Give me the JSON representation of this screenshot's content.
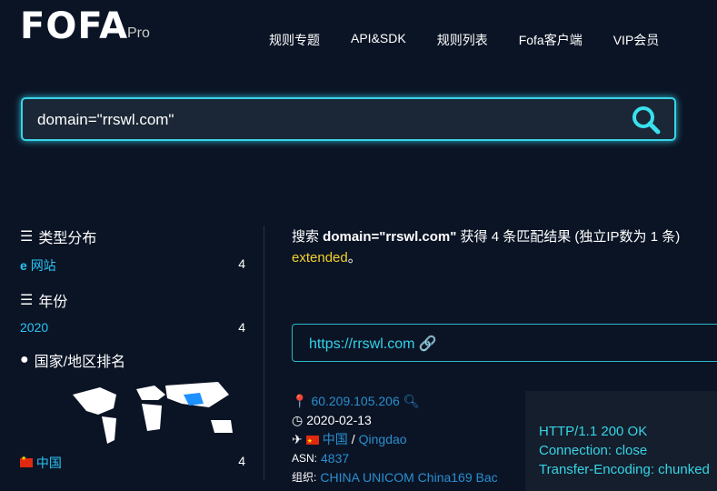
{
  "app": {
    "logo_text": "FOFA",
    "logo_sub": "Pro"
  },
  "nav": [
    "规则专题",
    "API&SDK",
    "规则列表",
    "Fofa客户端",
    "VIP会员"
  ],
  "search": {
    "value": "domain=\"rrswl.com\""
  },
  "sidebar": {
    "type_title": "类型分布",
    "type_items": [
      {
        "label": "网站",
        "count": "4"
      }
    ],
    "year_title": "年份",
    "year_items": [
      {
        "label": "2020",
        "count": "4"
      }
    ],
    "country_title": "国家/地区排名",
    "country_items": [
      {
        "label": "中国",
        "count": "4"
      }
    ]
  },
  "result": {
    "summary_prefix": "搜索 ",
    "query": "domain=\"rrswl.com\"",
    "summary_suffix": " 获得 4 条匹配结果 (独立IP数为 1 条)",
    "extended": "extended",
    "extended_suffix": "。",
    "url": "https://rrswl.com",
    "ip": "60.209.105.206",
    "date": "2020-02-13",
    "country": "中国",
    "city": "Qingdao",
    "asn_label": "ASN:",
    "asn": "4837",
    "org_label": "组织:",
    "org": "CHINA UNICOM China169 Bac",
    "http_lines": [
      "HTTP/1.1 200 OK",
      "Connection: close",
      "Transfer-Encoding: chunked"
    ]
  }
}
